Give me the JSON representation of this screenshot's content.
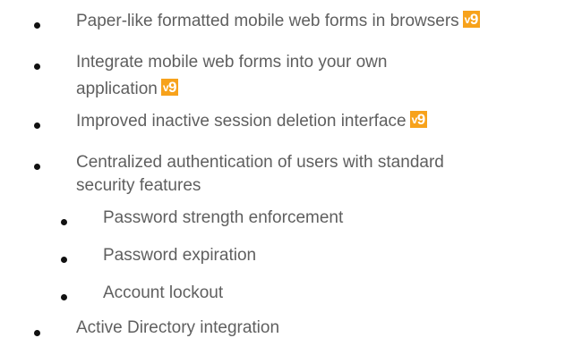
{
  "colors": {
    "text": "#5f5f5f",
    "bullet": "#111111",
    "badge_bg": "#f7a21b",
    "badge_text": "#ffffff"
  },
  "badge": {
    "prefix": "v",
    "number": "9"
  },
  "items": [
    {
      "text": "Paper-like formatted mobile web forms in browsers"
    },
    {
      "line1": "Integrate mobile web forms into your own",
      "line2": "application"
    },
    {
      "text": "Improved inactive session deletion interface"
    },
    {
      "line1": "Centralized authentication of users with standard",
      "line2": "security features"
    },
    {
      "text": "Password strength enforcement"
    },
    {
      "text": "Password expiration"
    },
    {
      "text": "Account lockout"
    },
    {
      "text": "Active Directory integration"
    }
  ]
}
